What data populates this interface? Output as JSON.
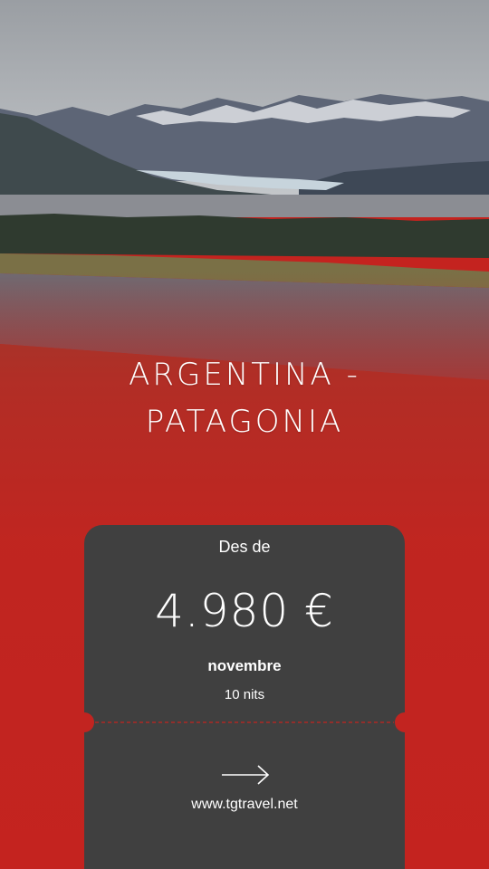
{
  "title": {
    "line1": "ARGENTINA -",
    "line2": "PATAGONIA"
  },
  "ticket": {
    "from_label": "Des de",
    "price": "4.980 €",
    "month": "novembre",
    "nights": "10 nits",
    "arrow_icon": "arrow-right-icon",
    "website": "www.tgtravel.net"
  },
  "colors": {
    "brand_red": "#c4231f",
    "ticket_bg": "#404040",
    "text": "#ffffff"
  }
}
